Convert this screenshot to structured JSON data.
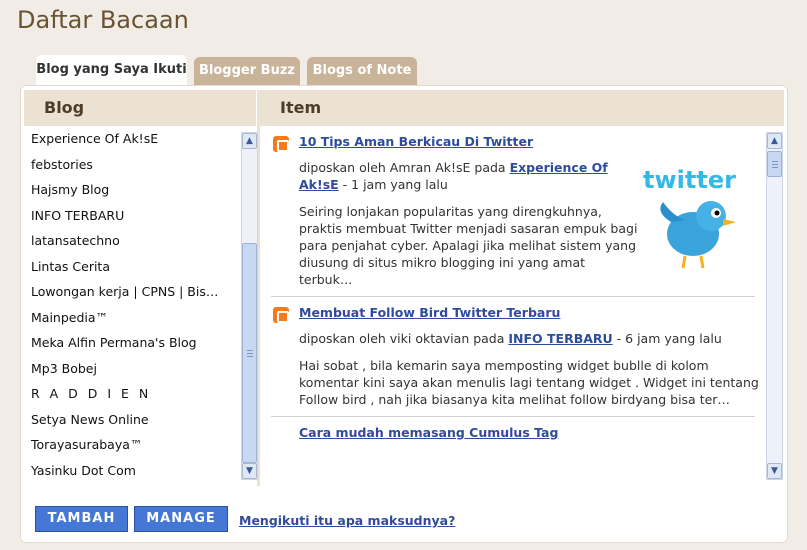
{
  "page_title": "Daftar Bacaan",
  "tabs": [
    {
      "label": "Blog yang Saya Ikuti",
      "active": true
    },
    {
      "label": "Blogger Buzz",
      "active": false
    },
    {
      "label": "Blogs of Note",
      "active": false
    }
  ],
  "columns": {
    "blog": "Blog",
    "item": "Item"
  },
  "blogs": [
    "Experience Of Ak!sE",
    "febstories",
    "Hajsmy Blog",
    "INFO TERBARU",
    "latansatechno",
    "Lintas Cerita",
    "Lowongan kerja | CPNS | Bis…",
    "Mainpedia™",
    "Meka Alfin Permana's Blog",
    "Mp3 Bobej",
    "R A D D I E N",
    "Setya News Online",
    "Torayasurabaya™",
    "Yasinku Dot Com"
  ],
  "items": [
    {
      "title": "10 Tips Aman Berkicau Di Twitter",
      "meta_prefix": "diposkan oleh Amran Ak!sE pada",
      "blog": "Experience Of Ak!sE",
      "meta_suffix": "- 1 jam yang lalu",
      "snippet": "Seiring lonjakan popularitas yang direngkuhnya, praktis membuat Twitter menjadi sasaran empuk bagi para penjahat cyber. Apalagi jika melihat sistem yang diusung di situs mikro blogging ini yang amat terbuk…",
      "image_text": "twitter"
    },
    {
      "title": "Membuat Follow Bird Twitter Terbaru",
      "meta_prefix": "diposkan oleh viki oktavian pada",
      "blog": "INFO TERBARU",
      "meta_suffix": "- 6 jam yang lalu",
      "snippet": "Hai sobat , bila kemarin saya memposting widget bublle di kolom komentar kini saya akan menulis lagi tentang widget . Widget ini tentang Follow bird , nah jika biasanya kita melihat follow birdyang bisa ter…"
    },
    {
      "title": "Cara mudah memasang Cumulus Tag"
    }
  ],
  "buttons": {
    "add": "TAMBAH",
    "manage": "MANAGE"
  },
  "help_link": "Mengikuti itu apa maksudnya?",
  "colors": {
    "accent": "#4577d6",
    "link": "#2c4d9b",
    "header_bg": "#ebe2d3",
    "tab_inactive": "#c9b49a",
    "title": "#6a5232"
  }
}
